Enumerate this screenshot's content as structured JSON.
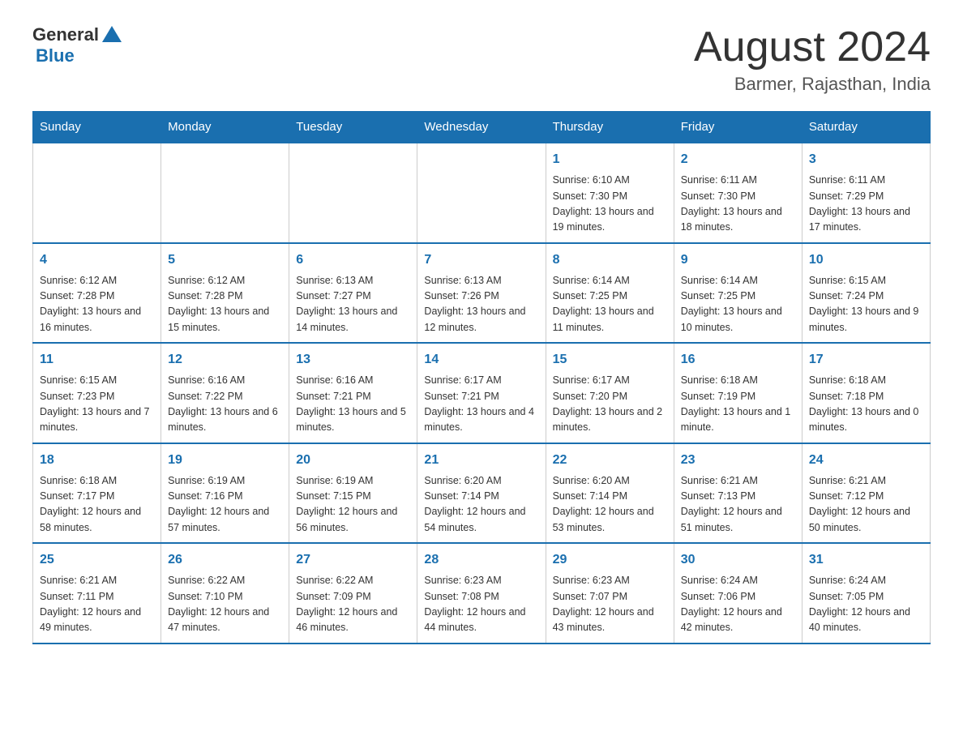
{
  "header": {
    "logo_general": "General",
    "logo_blue": "Blue",
    "month_title": "August 2024",
    "location": "Barmer, Rajasthan, India"
  },
  "days_of_week": [
    "Sunday",
    "Monday",
    "Tuesday",
    "Wednesday",
    "Thursday",
    "Friday",
    "Saturday"
  ],
  "weeks": [
    [
      {
        "day": "",
        "info": ""
      },
      {
        "day": "",
        "info": ""
      },
      {
        "day": "",
        "info": ""
      },
      {
        "day": "",
        "info": ""
      },
      {
        "day": "1",
        "info": "Sunrise: 6:10 AM\nSunset: 7:30 PM\nDaylight: 13 hours and 19 minutes."
      },
      {
        "day": "2",
        "info": "Sunrise: 6:11 AM\nSunset: 7:30 PM\nDaylight: 13 hours and 18 minutes."
      },
      {
        "day": "3",
        "info": "Sunrise: 6:11 AM\nSunset: 7:29 PM\nDaylight: 13 hours and 17 minutes."
      }
    ],
    [
      {
        "day": "4",
        "info": "Sunrise: 6:12 AM\nSunset: 7:28 PM\nDaylight: 13 hours and 16 minutes."
      },
      {
        "day": "5",
        "info": "Sunrise: 6:12 AM\nSunset: 7:28 PM\nDaylight: 13 hours and 15 minutes."
      },
      {
        "day": "6",
        "info": "Sunrise: 6:13 AM\nSunset: 7:27 PM\nDaylight: 13 hours and 14 minutes."
      },
      {
        "day": "7",
        "info": "Sunrise: 6:13 AM\nSunset: 7:26 PM\nDaylight: 13 hours and 12 minutes."
      },
      {
        "day": "8",
        "info": "Sunrise: 6:14 AM\nSunset: 7:25 PM\nDaylight: 13 hours and 11 minutes."
      },
      {
        "day": "9",
        "info": "Sunrise: 6:14 AM\nSunset: 7:25 PM\nDaylight: 13 hours and 10 minutes."
      },
      {
        "day": "10",
        "info": "Sunrise: 6:15 AM\nSunset: 7:24 PM\nDaylight: 13 hours and 9 minutes."
      }
    ],
    [
      {
        "day": "11",
        "info": "Sunrise: 6:15 AM\nSunset: 7:23 PM\nDaylight: 13 hours and 7 minutes."
      },
      {
        "day": "12",
        "info": "Sunrise: 6:16 AM\nSunset: 7:22 PM\nDaylight: 13 hours and 6 minutes."
      },
      {
        "day": "13",
        "info": "Sunrise: 6:16 AM\nSunset: 7:21 PM\nDaylight: 13 hours and 5 minutes."
      },
      {
        "day": "14",
        "info": "Sunrise: 6:17 AM\nSunset: 7:21 PM\nDaylight: 13 hours and 4 minutes."
      },
      {
        "day": "15",
        "info": "Sunrise: 6:17 AM\nSunset: 7:20 PM\nDaylight: 13 hours and 2 minutes."
      },
      {
        "day": "16",
        "info": "Sunrise: 6:18 AM\nSunset: 7:19 PM\nDaylight: 13 hours and 1 minute."
      },
      {
        "day": "17",
        "info": "Sunrise: 6:18 AM\nSunset: 7:18 PM\nDaylight: 13 hours and 0 minutes."
      }
    ],
    [
      {
        "day": "18",
        "info": "Sunrise: 6:18 AM\nSunset: 7:17 PM\nDaylight: 12 hours and 58 minutes."
      },
      {
        "day": "19",
        "info": "Sunrise: 6:19 AM\nSunset: 7:16 PM\nDaylight: 12 hours and 57 minutes."
      },
      {
        "day": "20",
        "info": "Sunrise: 6:19 AM\nSunset: 7:15 PM\nDaylight: 12 hours and 56 minutes."
      },
      {
        "day": "21",
        "info": "Sunrise: 6:20 AM\nSunset: 7:14 PM\nDaylight: 12 hours and 54 minutes."
      },
      {
        "day": "22",
        "info": "Sunrise: 6:20 AM\nSunset: 7:14 PM\nDaylight: 12 hours and 53 minutes."
      },
      {
        "day": "23",
        "info": "Sunrise: 6:21 AM\nSunset: 7:13 PM\nDaylight: 12 hours and 51 minutes."
      },
      {
        "day": "24",
        "info": "Sunrise: 6:21 AM\nSunset: 7:12 PM\nDaylight: 12 hours and 50 minutes."
      }
    ],
    [
      {
        "day": "25",
        "info": "Sunrise: 6:21 AM\nSunset: 7:11 PM\nDaylight: 12 hours and 49 minutes."
      },
      {
        "day": "26",
        "info": "Sunrise: 6:22 AM\nSunset: 7:10 PM\nDaylight: 12 hours and 47 minutes."
      },
      {
        "day": "27",
        "info": "Sunrise: 6:22 AM\nSunset: 7:09 PM\nDaylight: 12 hours and 46 minutes."
      },
      {
        "day": "28",
        "info": "Sunrise: 6:23 AM\nSunset: 7:08 PM\nDaylight: 12 hours and 44 minutes."
      },
      {
        "day": "29",
        "info": "Sunrise: 6:23 AM\nSunset: 7:07 PM\nDaylight: 12 hours and 43 minutes."
      },
      {
        "day": "30",
        "info": "Sunrise: 6:24 AM\nSunset: 7:06 PM\nDaylight: 12 hours and 42 minutes."
      },
      {
        "day": "31",
        "info": "Sunrise: 6:24 AM\nSunset: 7:05 PM\nDaylight: 12 hours and 40 minutes."
      }
    ]
  ]
}
